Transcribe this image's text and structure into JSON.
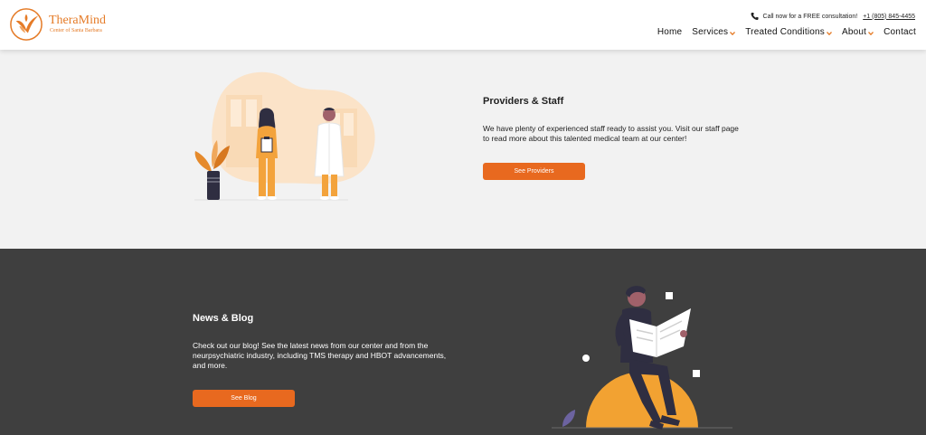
{
  "header": {
    "logo_name": "TheraMind",
    "logo_sub": "Center of Santa Barbara",
    "call_text": "Call now for a FREE consultation!",
    "call_number": "+1 (805) 845-4455",
    "nav": [
      {
        "label": "Home",
        "dropdown": false
      },
      {
        "label": "Services",
        "dropdown": true
      },
      {
        "label": "Treated Conditions",
        "dropdown": true
      },
      {
        "label": "About",
        "dropdown": true
      },
      {
        "label": "Contact",
        "dropdown": false
      }
    ]
  },
  "providers": {
    "title": "Providers & Staff",
    "text": "We have plenty of experienced staff ready to assist you. Visit our staff page to read more about this talented medical team at our center!",
    "button": "See Providers"
  },
  "news": {
    "title": "News & Blog",
    "text": "Check out our blog! See the latest news from our center and from the neurpsychiatric industry, including TMS therapy and HBOT advancements, and more.",
    "button": "See Blog"
  },
  "colors": {
    "brand": "#e57b27",
    "button": "#e8691f",
    "dark_section": "#3f3f3f",
    "light_section": "#f2f2f2"
  },
  "icons": {
    "logo": "phoenix-logo-icon",
    "phone": "phone-icon",
    "caret": "chevron-down-icon"
  }
}
